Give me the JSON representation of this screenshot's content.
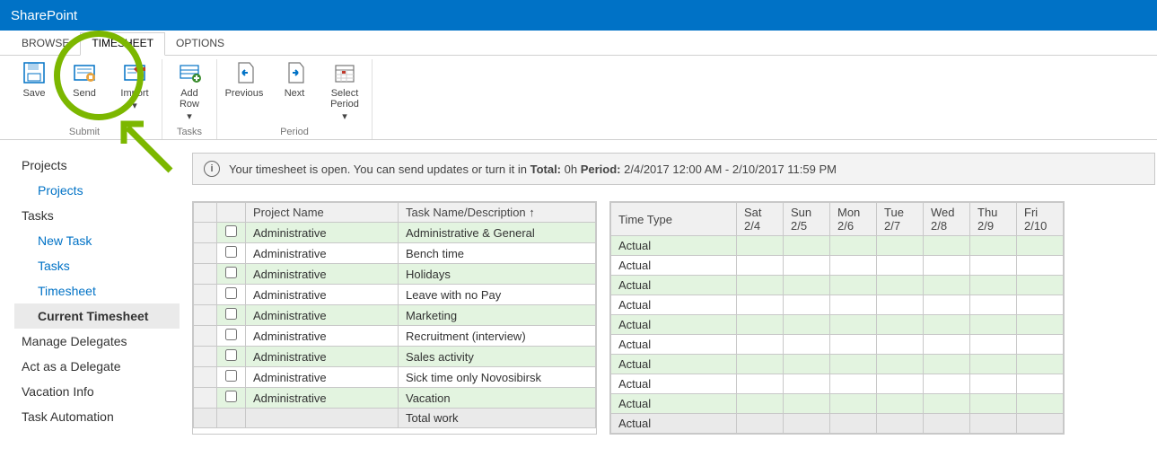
{
  "brand": "SharePoint",
  "tabs": {
    "browse": "BROWSE",
    "timesheet": "TIMESHEET",
    "options": "OPTIONS"
  },
  "ribbon": {
    "save": "Save",
    "send": "Send",
    "import": "Import",
    "add_row": "Add Row",
    "previous": "Previous",
    "next": "Next",
    "select_period": "Select Period",
    "group_submit": "Submit",
    "group_tasks": "Tasks",
    "group_period": "Period"
  },
  "nav": {
    "projects": "Projects",
    "projects_sub": "Projects",
    "tasks": "Tasks",
    "new_task": "New Task",
    "tasks_sub": "Tasks",
    "timesheet": "Timesheet",
    "current_timesheet": "Current Timesheet",
    "manage_delegates": "Manage Delegates",
    "act_as_delegate": "Act as a Delegate",
    "vacation_info": "Vacation Info",
    "task_automation": "Task Automation"
  },
  "message": {
    "prefix": "Your timesheet is open. You can send updates or turn it in ",
    "total_label": "Total:",
    "total_value": " 0h ",
    "period_label": "Period:",
    "period_value": " 2/4/2017 12:00 AM - 2/10/2017 11:59 PM"
  },
  "table1": {
    "headers": {
      "project": "Project Name",
      "task": "Task Name/Description ↑"
    },
    "rows": [
      {
        "project": "Administrative",
        "task": "Administrative & General"
      },
      {
        "project": "Administrative",
        "task": "Bench time"
      },
      {
        "project": "Administrative",
        "task": "Holidays"
      },
      {
        "project": "Administrative",
        "task": "Leave with no Pay"
      },
      {
        "project": "Administrative",
        "task": "Marketing"
      },
      {
        "project": "Administrative",
        "task": "Recruitment (interview)"
      },
      {
        "project": "Administrative",
        "task": "Sales activity"
      },
      {
        "project": "Administrative",
        "task": "Sick time only Novosibirsk"
      },
      {
        "project": "Administrative",
        "task": "Vacation"
      }
    ],
    "total_label": "Total work"
  },
  "table2": {
    "headers": {
      "timetype": "Time Type",
      "days": [
        "Sat 2/4",
        "Sun 2/5",
        "Mon 2/6",
        "Tue 2/7",
        "Wed 2/8",
        "Thu 2/9",
        "Fri 2/10"
      ]
    },
    "actual": "Actual"
  }
}
